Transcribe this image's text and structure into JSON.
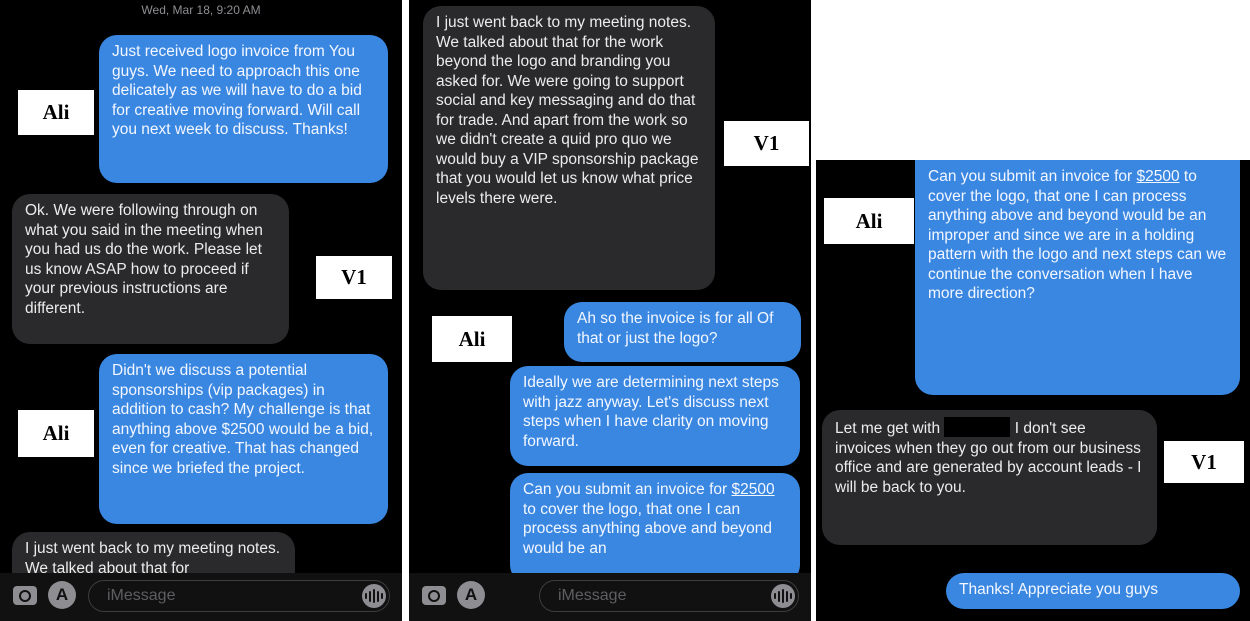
{
  "panel1": {
    "timestamp": "Wed, Mar 18, 9:20 AM",
    "messages": [
      "Just received logo invoice from You guys. We need to approach this one delicately as we will have to do a bid for creative moving forward. Will call you next week to discuss.  Thanks!",
      "Ok. We were following through on what you said in the meeting when you had us do the work. Please let us know ASAP how to proceed if your previous instructions are different.",
      "Didn't we discuss a potential sponsorships (vip packages) in addition to cash? My challenge is that anything above $2500 would be a bid, even for creative. That has changed since we briefed the project.",
      "I just went back to my meeting notes. We talked about that for"
    ],
    "labels": [
      "Ali",
      "V1",
      "Ali"
    ],
    "input_placeholder": "iMessage"
  },
  "panel2": {
    "messages": [
      "I just went back to my meeting notes. We talked about that for the work beyond the logo and branding you asked for. We were going to support social and key messaging and do that for trade. And apart from the work so we didn't create a quid pro quo we would buy a VIP sponsorship package that you would let us know what price levels there were.",
      "Ah so the invoice is for all Of that or just the logo?",
      "Ideally we are determining next steps with jazz anyway. Let's discuss next steps when I have clarity on moving forward.",
      "Can you submit an invoice for $2500 to cover the logo, that one I can process anything above and beyond would be an"
    ],
    "labels": [
      "V1",
      "Ali"
    ],
    "input_placeholder": "iMessage"
  },
  "panel3": {
    "messages": [
      "Can you submit an invoice for $2500 to cover the logo, that one I can process anything above and beyond would be an improper and since we are in a holding pattern with the logo and next steps can we continue the conversation when I have more direction?",
      "Let me get with",
      "I don't see invoices when they go out from our business office and are generated by account leads - I will be back to you.",
      "Thanks! Appreciate you guys"
    ],
    "labels": [
      "Ali",
      "V1"
    ]
  },
  "colors": {
    "sent_bubble": "#3a87e2",
    "received_bubble": "#2a2a2c",
    "background": "#000000"
  }
}
